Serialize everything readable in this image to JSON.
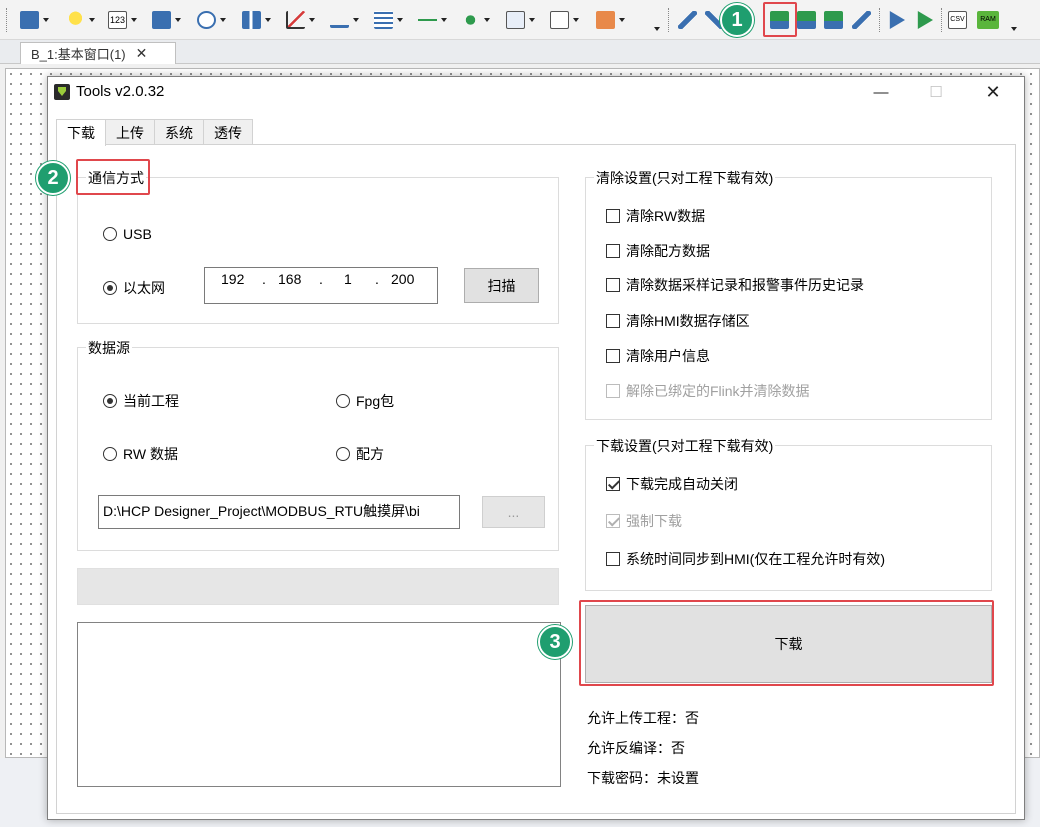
{
  "toolbar": {
    "icons": [
      "bit-lamp-icon",
      "light-bulb-icon",
      "number-display-icon",
      "bit-switch-icon",
      "clock-icon",
      "bar-graph-icon",
      "trend-chart-icon",
      "scale-icon",
      "table-icon",
      "slider-icon",
      "move-icon",
      "text-display-icon",
      "notes-icon",
      "image-icon"
    ],
    "right_icons": [
      "compile-icon",
      "simulate-icon",
      "download-icon",
      "download-alt-icon",
      "upload-icon",
      "transfer-icon",
      "run-online-icon",
      "run-offline-icon",
      "csv-icon",
      "ram-icon"
    ]
  },
  "badges": [
    "1",
    "2",
    "3"
  ],
  "doc_tab": {
    "label": "B_1:基本窗口(1)",
    "close": "✕"
  },
  "dialog": {
    "title": "Tools v2.0.32",
    "minimize": "—",
    "maximize": "☐",
    "close": "✕",
    "tabs": [
      "下载",
      "上传",
      "系统",
      "透传"
    ],
    "comm": {
      "label": "通信方式",
      "usb": "USB",
      "ethernet": "以太网",
      "ethernet_selected": true,
      "ip": [
        "192",
        "168",
        "1",
        "200"
      ],
      "scan": "扫描"
    },
    "source": {
      "label": "数据源",
      "current_project": "当前工程",
      "fpg": "Fpg包",
      "rw_data": "RW 数据",
      "recipe": "配方",
      "path": "D:\\HCP Designer_Project\\MODBUS_RTU触摸屏\\bi",
      "browse": "..."
    },
    "clear": {
      "label": "清除设置(只对工程下载有效)",
      "items": [
        {
          "text": "清除RW数据",
          "checked": false,
          "disabled": false
        },
        {
          "text": "清除配方数据",
          "checked": false,
          "disabled": false
        },
        {
          "text": "清除数据采样记录和报警事件历史记录",
          "checked": false,
          "disabled": false
        },
        {
          "text": "清除HMI数据存储区",
          "checked": false,
          "disabled": false
        },
        {
          "text": "清除用户信息",
          "checked": false,
          "disabled": false
        },
        {
          "text": "解除已绑定的Flink并清除数据",
          "checked": false,
          "disabled": true
        }
      ]
    },
    "download_settings": {
      "label": "下载设置(只对工程下载有效)",
      "items": [
        {
          "text": "下载完成自动关闭",
          "checked": true,
          "disabled": false
        },
        {
          "text": "强制下载",
          "checked": true,
          "disabled": true
        },
        {
          "text": "系统时间同步到HMI(仅在工程允许时有效)",
          "checked": false,
          "disabled": false
        }
      ]
    },
    "download_button": "下载",
    "info": {
      "allow_upload": "允许上传工程：否",
      "allow_decompile": "允许反编译：否",
      "password": "下载密码：未设置"
    }
  },
  "colors": {
    "highlight": "#e0474c",
    "badge": "#1f9e6f"
  }
}
